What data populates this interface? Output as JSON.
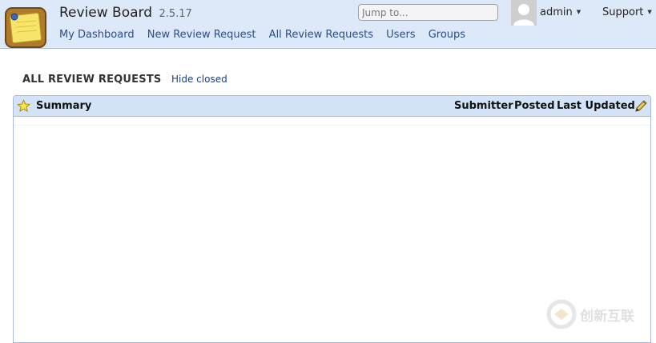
{
  "header": {
    "title": "Review Board",
    "version": "2.5.17",
    "search_placeholder": "Jump to...",
    "user_label": "admin",
    "support_label": "Support",
    "nav": [
      {
        "label": "My Dashboard"
      },
      {
        "label": "New Review Request"
      },
      {
        "label": "All Review Requests"
      },
      {
        "label": "Users"
      },
      {
        "label": "Groups"
      }
    ]
  },
  "main": {
    "section_title": "ALL REVIEW REQUESTS",
    "hide_closed_label": "Hide closed",
    "columns": {
      "summary": "Summary",
      "submitter": "Submitter",
      "posted": "Posted",
      "last_updated": "Last Updated"
    },
    "rows": []
  },
  "watermark": {
    "text": "创新互联"
  },
  "icons": {
    "logo": "notepad-logo-icon",
    "avatar": "user-silhouette-icon",
    "star": "star-icon",
    "edit_columns": "pencil-icon"
  },
  "colors": {
    "header_bg": "#dde8f8",
    "grid_header_bg": "#d3e3f8",
    "link": "#2a4d8f",
    "border": "#a9b9d3"
  }
}
